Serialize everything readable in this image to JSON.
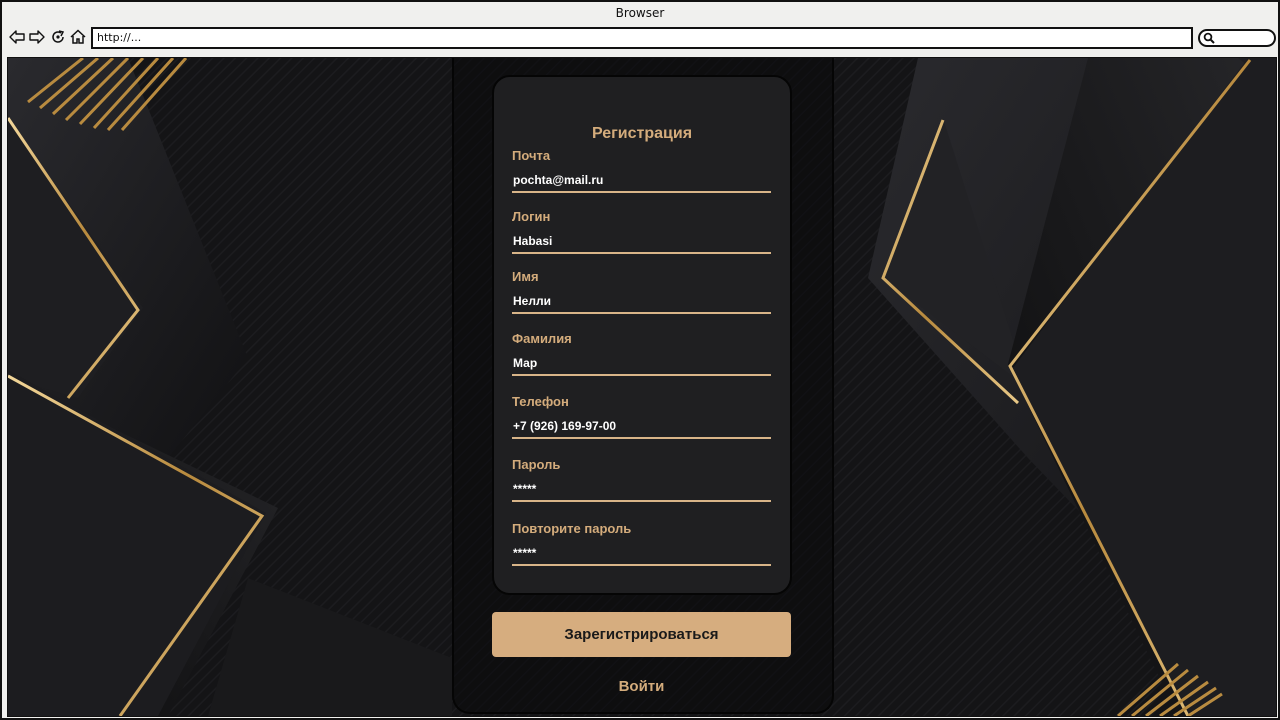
{
  "browser": {
    "title": "Browser",
    "url": "http://..."
  },
  "form": {
    "title": "Регистрация",
    "fields": [
      {
        "label": "Почта",
        "value": "pochta@mail.ru"
      },
      {
        "label": "Логин",
        "value": "Habasi"
      },
      {
        "label": "Имя",
        "value": "Нелли"
      },
      {
        "label": "Фамилия",
        "value": "Мар"
      },
      {
        "label": "Телефон",
        "value": "+7 (926) 169-97-00"
      },
      {
        "label": "Пароль",
        "value": "*****"
      },
      {
        "label": "Повторите пароль",
        "value": "*****"
      }
    ],
    "register_label": "Зарегистрироваться",
    "login_label": "Войти"
  },
  "colors": {
    "accent": "#d4ac7c",
    "background": "#121214",
    "card": "#1f1f21",
    "gold": "#c8a05a"
  },
  "icons": [
    "back-icon",
    "forward-icon",
    "reload-icon",
    "home-icon",
    "search-icon"
  ]
}
